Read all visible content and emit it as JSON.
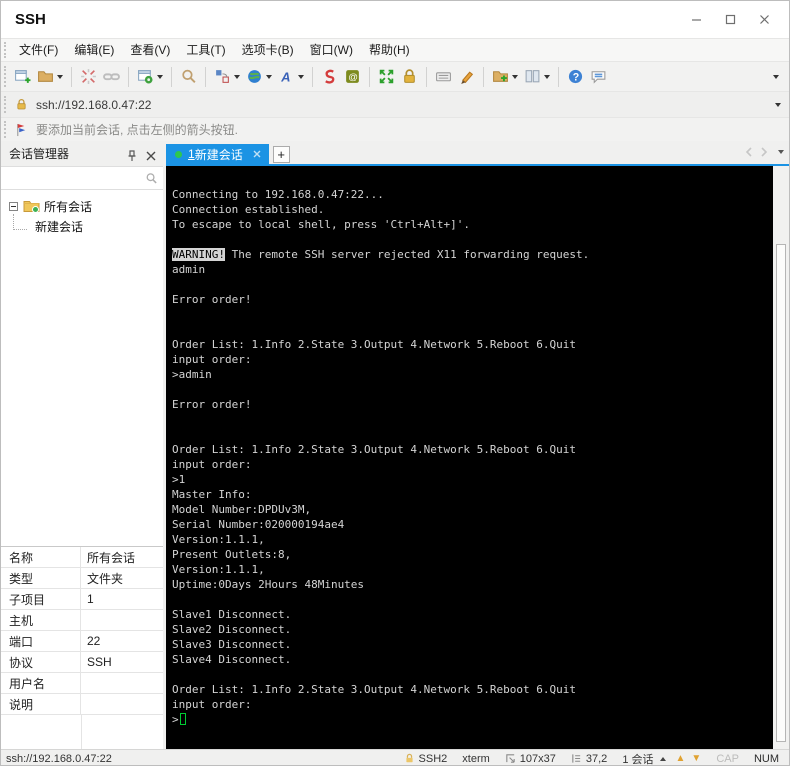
{
  "window": {
    "title": "SSH"
  },
  "colors": {
    "accent": "#1b93e4",
    "termfg": "#d4d4d4",
    "cursor": "#00cc33"
  },
  "menu_bar": {
    "items": [
      "文件(F)",
      "编辑(E)",
      "查看(V)",
      "工具(T)",
      "选项卡(B)",
      "窗口(W)",
      "帮助(H)"
    ]
  },
  "toolbar": {
    "buttons": [
      {
        "icon": "new-session-icon"
      },
      {
        "icon": "open-folder-icon",
        "caret": true
      },
      {
        "sep": true
      },
      {
        "icon": "disconnect-icon"
      },
      {
        "icon": "reconnect-icon"
      },
      {
        "sep": true
      },
      {
        "icon": "session-properties-icon",
        "caret": true
      },
      {
        "sep": true
      },
      {
        "icon": "find-icon"
      },
      {
        "sep": true
      },
      {
        "icon": "compose-icon",
        "caret": true
      },
      {
        "icon": "encoding-icon",
        "caret": true
      },
      {
        "icon": "font-icon",
        "caret": true
      },
      {
        "sep": true
      },
      {
        "icon": "xagent-icon"
      },
      {
        "icon": "zmodem-icon"
      },
      {
        "sep": true
      },
      {
        "icon": "fullscreen-icon"
      },
      {
        "icon": "toolbar-lock-icon"
      },
      {
        "sep": true
      },
      {
        "icon": "keyboard-icon"
      },
      {
        "icon": "highlighter-icon"
      },
      {
        "sep": true
      },
      {
        "icon": "new-folder-icon",
        "caret": true
      },
      {
        "icon": "tile-windows-icon",
        "caret": true
      },
      {
        "sep": true
      },
      {
        "icon": "help-icon"
      },
      {
        "icon": "chat-icon"
      }
    ]
  },
  "address_bar": {
    "value": "ssh://192.168.0.47:22"
  },
  "notice_bar": {
    "text": "要添加当前会话, 点击左侧的箭头按钮."
  },
  "sidebar": {
    "header": {
      "title": "会话管理器"
    },
    "search": {
      "placeholder": ""
    },
    "tree": [
      {
        "label": "所有会话"
      },
      {
        "label": "新建会话"
      }
    ],
    "properties": [
      {
        "label": "名称",
        "value": "所有会话"
      },
      {
        "label": "类型",
        "value": "文件夹"
      },
      {
        "label": "子项目",
        "value": "1"
      },
      {
        "label": "主机",
        "value": ""
      },
      {
        "label": "端口",
        "value": "22"
      },
      {
        "label": "协议",
        "value": "SSH"
      },
      {
        "label": "用户名",
        "value": ""
      },
      {
        "label": "说明",
        "value": ""
      }
    ]
  },
  "tab_bar": {
    "tabs": [
      {
        "number": "1",
        "title": "新建会话",
        "active": true
      }
    ],
    "new_tab_label": "+"
  },
  "terminal": {
    "lines": [
      [
        {
          "text": "Connecting to 192.168.0.47:22..."
        }
      ],
      [
        {
          "text": "Connection established."
        }
      ],
      [
        {
          "text": "To escape to local shell, press 'Ctrl+Alt+]'."
        }
      ],
      [],
      [
        {
          "text": "WARNING!",
          "invert": true
        },
        {
          "text": " The remote SSH server rejected X11 forwarding request."
        }
      ],
      [
        {
          "text": "admin"
        }
      ],
      [],
      [
        {
          "text": "Error order!"
        }
      ],
      [],
      [],
      [
        {
          "text": "Order List: 1.Info 2.State 3.Output 4.Network 5.Reboot 6.Quit"
        }
      ],
      [
        {
          "text": "input order:"
        }
      ],
      [
        {
          "text": ">admin"
        }
      ],
      [],
      [
        {
          "text": "Error order!"
        }
      ],
      [],
      [],
      [
        {
          "text": "Order List: 1.Info 2.State 3.Output 4.Network 5.Reboot 6.Quit"
        }
      ],
      [
        {
          "text": "input order:"
        }
      ],
      [
        {
          "text": ">1"
        }
      ],
      [
        {
          "text": "Master Info:"
        }
      ],
      [
        {
          "text": "Model Number:DPDUv3M,"
        }
      ],
      [
        {
          "text": "Serial Number:020000194ae4"
        }
      ],
      [
        {
          "text": "Version:1.1.1,"
        }
      ],
      [
        {
          "text": "Present Outlets:8,"
        }
      ],
      [
        {
          "text": "Version:1.1.1,"
        }
      ],
      [
        {
          "text": "Uptime:0Days 2Hours 48Minutes"
        }
      ],
      [],
      [
        {
          "text": "Slave1 Disconnect."
        }
      ],
      [
        {
          "text": "Slave2 Disconnect."
        }
      ],
      [
        {
          "text": "Slave3 Disconnect."
        }
      ],
      [
        {
          "text": "Slave4 Disconnect."
        }
      ],
      [],
      [
        {
          "text": "Order List: 1.Info 2.State 3.Output 4.Network 5.Reboot 6.Quit"
        }
      ],
      [
        {
          "text": "input order:"
        }
      ],
      [
        {
          "text": ">"
        },
        {
          "cursor": true
        }
      ]
    ]
  },
  "status_bar": {
    "left": "ssh://192.168.0.47:22",
    "protocol": "SSH2",
    "terminal_type": "xterm",
    "screen_size": "107x37",
    "cursor_position": "37,2",
    "session_count": "1 会话",
    "caps_lock": "CAP",
    "num_lock": "NUM"
  }
}
